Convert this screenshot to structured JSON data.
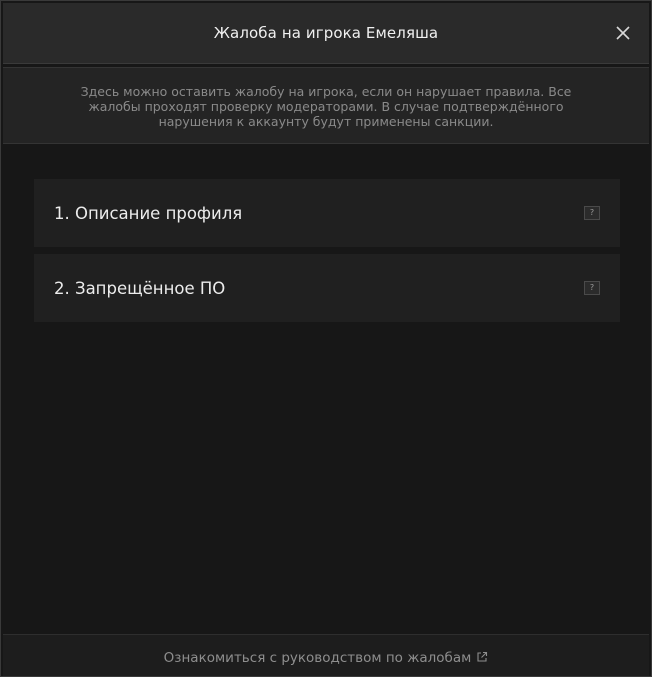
{
  "dialog": {
    "title": "Жалоба на игрока Емеляша",
    "close_icon": "close-icon"
  },
  "info": {
    "text": "Здесь можно оставить жалобу на игрока, если он нарушает правила. Все жалобы проходят проверку модераторами. В случае подтверждённого нарушения к аккаунту будут применены санкции."
  },
  "categories": [
    {
      "label": "1. Описание профиля",
      "help": "?"
    },
    {
      "label": "2. Запрещённое ПО",
      "help": "?"
    }
  ],
  "footer": {
    "link_text": "Ознакомиться с руководством по жалобам",
    "link_icon": "external-link-icon"
  },
  "colors": {
    "background": "#171717",
    "header": "#2a2a2a",
    "info": "#242424",
    "item": "#202020",
    "muted_text": "#8a8a8a"
  }
}
